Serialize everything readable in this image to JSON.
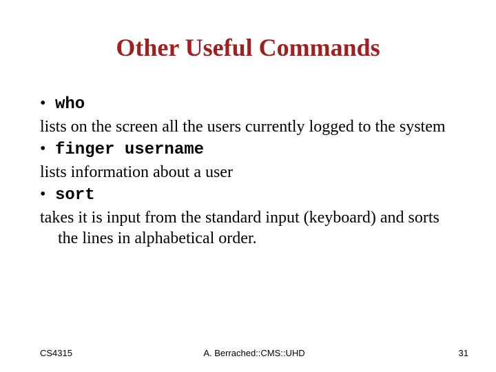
{
  "title": "Other Useful Commands",
  "items": [
    {
      "cmd": "who",
      "desc": "lists on the screen all the users currently logged to the system"
    },
    {
      "cmd": "finger  username",
      "desc": "lists information about a user"
    },
    {
      "cmd": "sort",
      "desc": "takes it is input from the standard input (keyboard) and sorts the lines in alphabetical order."
    }
  ],
  "footer": {
    "left": "CS4315",
    "center": "A. Berrached::CMS::UHD",
    "right": "31"
  }
}
